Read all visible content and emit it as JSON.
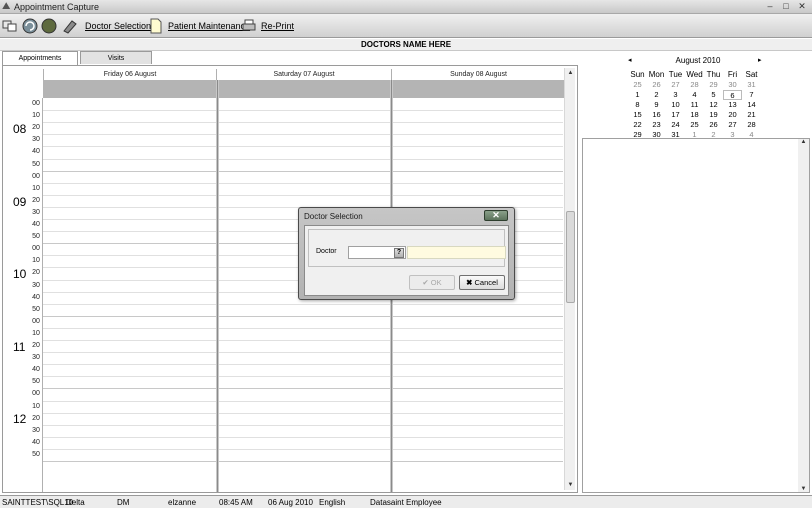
{
  "window": {
    "title": "Appointment Capture"
  },
  "toolbar": {
    "doctor_selection": "Doctor Selection",
    "patient_maintenance": "Patient Maintenance",
    "reprint": "Re-Print"
  },
  "header": {
    "doctor_name": "DOCTORS NAME HERE"
  },
  "tabs": [
    {
      "label": "Appointments",
      "active": true
    },
    {
      "label": "Visits",
      "active": false
    }
  ],
  "schedule": {
    "days": [
      "Friday 06 August",
      "Saturday 07 August",
      "Sunday 08 August"
    ],
    "hours": [
      "08",
      "09",
      "10",
      "11",
      "12"
    ],
    "minutes": [
      "00",
      "10",
      "20",
      "30",
      "40",
      "50"
    ]
  },
  "mini_calendar": {
    "month_label": "August 2010",
    "prev_symbol": "◂",
    "next_symbol": "▸",
    "weekdays": [
      "Sun",
      "Mon",
      "Tue",
      "Wed",
      "Thu",
      "Fri",
      "Sat"
    ],
    "weeks": [
      [
        "25",
        "26",
        "27",
        "28",
        "29",
        "30",
        "31"
      ],
      [
        "1",
        "2",
        "3",
        "4",
        "5",
        "6",
        "7"
      ],
      [
        "8",
        "9",
        "10",
        "11",
        "12",
        "13",
        "14"
      ],
      [
        "15",
        "16",
        "17",
        "18",
        "19",
        "20",
        "21"
      ],
      [
        "22",
        "23",
        "24",
        "25",
        "26",
        "27",
        "28"
      ],
      [
        "29",
        "30",
        "31",
        "1",
        "2",
        "3",
        "4"
      ]
    ],
    "today": "6"
  },
  "status_bar": {
    "server": "SAINTTEST\\SQL10",
    "database": "Delta",
    "code": "DM",
    "user": "elzanne",
    "time": "08:45 AM",
    "date": "06 Aug 2010",
    "language": "English",
    "role": "Datasaint Employee"
  },
  "dialog": {
    "title": "Doctor Selection",
    "field_label": "Doctor",
    "field_value": "",
    "lookup_label": "?",
    "ok_label": "OK",
    "cancel_label": "Cancel",
    "close_symbol": "✕"
  }
}
